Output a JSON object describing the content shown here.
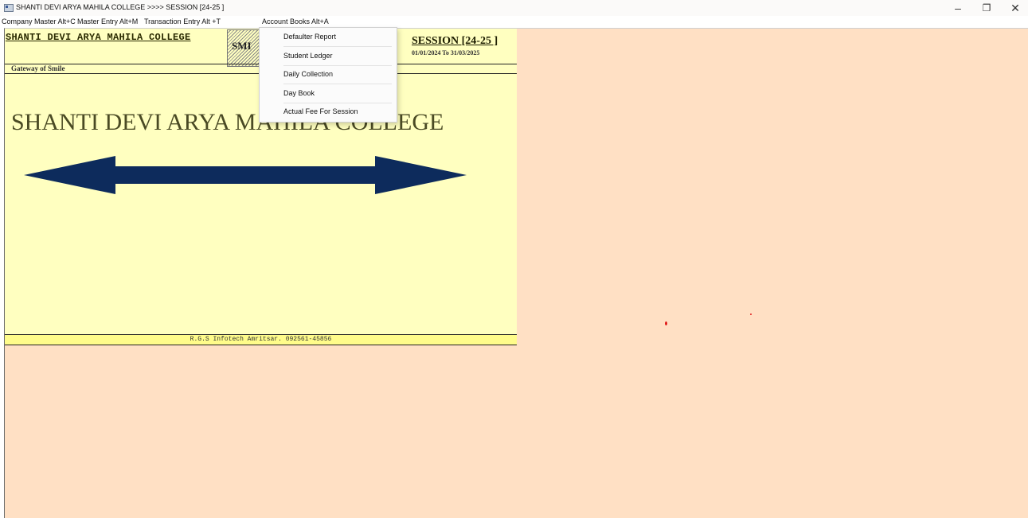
{
  "window": {
    "title": "SHANTI DEVI ARYA MAHILA COLLEGE   >>>> SESSION [24-25 ]",
    "controls": {
      "minimize": "–",
      "maximize": "❐",
      "close": "✕"
    }
  },
  "menubar": {
    "items": [
      {
        "label": "Company Master Alt+C"
      },
      {
        "label": "Master Entry Alt+M"
      },
      {
        "label": "Transaction Entry Alt +T"
      },
      {
        "label": "Account Books Alt+A"
      }
    ]
  },
  "dropdown": {
    "items": [
      {
        "label": "Defaulter Report"
      },
      {
        "label": "Student Ledger"
      },
      {
        "label": "Daily Collection"
      },
      {
        "label": "Day Book"
      },
      {
        "label": "Actual Fee For Session"
      }
    ]
  },
  "panel": {
    "header_title": "SHANTI DEVI ARYA MAHILA COLLEGE",
    "header_short": "SMI",
    "session": "SESSION [24-25 ]",
    "session_dates": "01/01/2024 To 31/03/2025",
    "tagline": "Gateway of Smile",
    "big_title": "SHANTI DEVI ARYA MAHILA COLLEGE",
    "footer": "R.G.S Infotech Amritsar. 092561-45856"
  },
  "colors": {
    "desktop_bg": "#ffe0c4",
    "panel_bg": "#ffffc0",
    "arrow_fill": "#0d2b5c",
    "footer_bg": "#fffc8a"
  }
}
